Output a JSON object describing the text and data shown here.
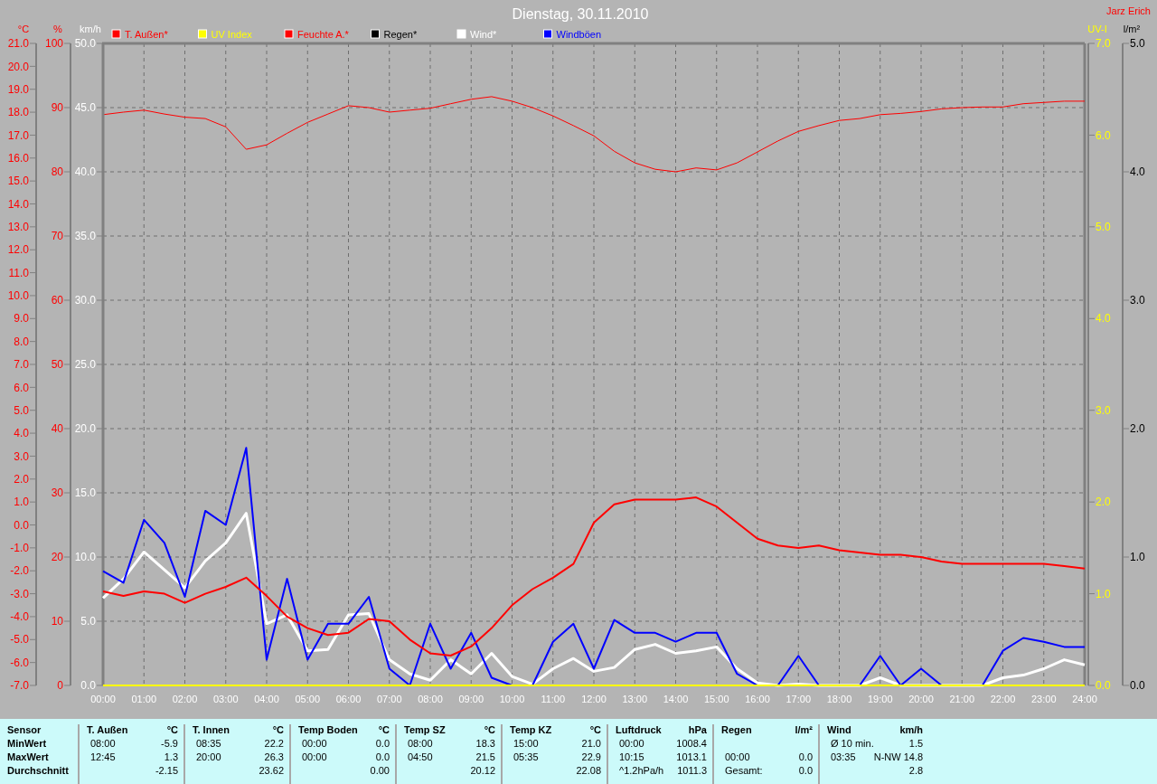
{
  "chart": {
    "title": "Dienstag, 30.11.2010",
    "author": "Jarz Erich",
    "panels": [
      {
        "chart_data": {
          "type": "line",
          "ylabel": "°C",
          "ylim": [
            -7,
            21
          ],
          "xlim": [
            0,
            24
          ],
          "grid": true,
          "x": [
            0,
            0.5,
            1,
            1.5,
            2,
            2.5,
            3,
            3.5,
            4,
            4.5,
            5,
            5.5,
            6,
            6.5,
            7,
            7.5,
            8,
            8.5,
            9,
            9.5,
            10,
            10.5,
            11,
            11.5,
            12,
            12.5,
            13,
            13.5,
            14,
            14.5,
            15,
            15.5,
            16,
            16.5,
            17,
            17.5,
            18,
            18.5,
            19,
            19.5,
            20,
            20.5,
            21,
            21.5,
            22,
            22.5,
            23,
            23.5,
            24
          ],
          "xticks": [
            {
              "value": 0,
              "label": "00:00"
            },
            {
              "value": 1,
              "label": "01:00"
            },
            {
              "value": 2,
              "label": "02:00"
            },
            {
              "value": 3,
              "label": "03:00"
            },
            {
              "value": 4,
              "label": "04:00"
            },
            {
              "value": 5,
              "label": "05:00"
            },
            {
              "value": 6,
              "label": "06:00"
            },
            {
              "value": 7,
              "label": "07:00"
            },
            {
              "value": 8,
              "label": "08:00"
            },
            {
              "value": 9,
              "label": "09:00"
            },
            {
              "value": 10,
              "label": "10:00"
            },
            {
              "value": 11,
              "label": "11:00"
            },
            {
              "value": 12,
              "label": "12:00"
            },
            {
              "value": 13,
              "label": "13:00"
            },
            {
              "value": 14,
              "label": "14:00"
            },
            {
              "value": 15,
              "label": "15:00"
            },
            {
              "value": 16,
              "label": "16:00"
            },
            {
              "value": 17,
              "label": "17:00"
            },
            {
              "value": 18,
              "label": "18:00"
            },
            {
              "value": 19,
              "label": "19:00"
            },
            {
              "value": 20,
              "label": "20:00"
            },
            {
              "value": 21,
              "label": "21:00"
            },
            {
              "value": 22,
              "label": "22:00"
            },
            {
              "value": 23,
              "label": "23:00"
            },
            {
              "value": 24,
              "label": "24:00"
            }
          ],
          "yticks": [
            {
              "value": -7,
              "label": "-7.0"
            },
            {
              "value": -6,
              "label": "-6.0"
            },
            {
              "value": -5,
              "label": "-5.0"
            },
            {
              "value": -4,
              "label": "-4.0"
            },
            {
              "value": -3,
              "label": "-3.0"
            },
            {
              "value": -2,
              "label": "-2.0"
            },
            {
              "value": -1,
              "label": "-1.0"
            },
            {
              "value": 0,
              "label": "0.0"
            },
            {
              "value": 1,
              "label": "1.0"
            },
            {
              "value": 2,
              "label": "2.0"
            },
            {
              "value": 3,
              "label": "3.0"
            },
            {
              "value": 4,
              "label": "4.0"
            },
            {
              "value": 5,
              "label": "5.0"
            },
            {
              "value": 6,
              "label": "6.0"
            },
            {
              "value": 7,
              "label": "7.0"
            },
            {
              "value": 8,
              "label": "8.0"
            },
            {
              "value": 9,
              "label": "9.0"
            },
            {
              "value": 10,
              "label": "10.0"
            },
            {
              "value": 11,
              "label": "11.0"
            },
            {
              "value": 12,
              "label": "12.0"
            },
            {
              "value": 13,
              "label": "13.0"
            },
            {
              "value": 14,
              "label": "14.0"
            },
            {
              "value": 15,
              "label": "15.0"
            },
            {
              "value": 16,
              "label": "16.0"
            },
            {
              "value": 17,
              "label": "17.0"
            },
            {
              "value": 18,
              "label": "18.0"
            },
            {
              "value": 19,
              "label": "19.0"
            },
            {
              "value": 20,
              "label": "20.0"
            },
            {
              "value": 21,
              "label": "21.0"
            }
          ],
          "series": [
            {
              "name": "T. Außen*",
              "color": "#ff0000",
              "values": [
                -2.9,
                -3.1,
                -2.9,
                -3.0,
                -3.4,
                -3.0,
                -2.7,
                -2.3,
                -3.1,
                -4.0,
                -4.5,
                -4.8,
                -4.7,
                -4.1,
                -4.2,
                -5.0,
                -5.6,
                -5.7,
                -5.3,
                -4.5,
                -3.5,
                -2.8,
                -2.3,
                -1.7,
                0.1,
                0.9,
                1.1,
                1.1,
                1.1,
                1.2,
                0.8,
                0.1,
                -0.6,
                -0.9,
                -1.0,
                -0.9,
                -1.1,
                -1.2,
                -1.3,
                -1.3,
                -1.4,
                -1.6,
                -1.7,
                -1.7,
                -1.7,
                -1.7,
                -1.7,
                -1.8,
                -1.9
              ]
            }
          ]
        }
      },
      {
        "chart_data": {
          "type": "line",
          "ylabel": "UV-I",
          "ylim": [
            0,
            7
          ],
          "categories": [
            null,
            null,
            null,
            null,
            null,
            null,
            null,
            null,
            null,
            null,
            null,
            null,
            null,
            null,
            null,
            null,
            null,
            null,
            null,
            null,
            null,
            null,
            null,
            null,
            null,
            null,
            null,
            null,
            null,
            null,
            null,
            null,
            null,
            null,
            null,
            null,
            null,
            null,
            null,
            null,
            null,
            null,
            null,
            null,
            null,
            null,
            null,
            null,
            null
          ],
          "yticks": [
            {
              "value": 0,
              "label": "0.0"
            },
            {
              "value": 1,
              "label": "1.0"
            },
            {
              "value": 2,
              "label": "2.0"
            },
            {
              "value": 3,
              "label": "3.0"
            },
            {
              "value": 4,
              "label": "4.0"
            },
            {
              "value": 5,
              "label": "5.0"
            },
            {
              "value": 6,
              "label": "6.0"
            },
            {
              "value": 7,
              "label": "7.0"
            }
          ],
          "series": [
            {
              "name": "UV Index",
              "color": "#ffff00",
              "values": [
                0,
                0,
                0,
                0,
                0,
                0,
                0,
                0,
                0,
                0,
                0,
                0,
                0,
                0,
                0,
                0,
                0,
                0,
                0,
                0,
                0,
                0,
                0,
                0,
                0,
                0,
                0,
                0,
                0,
                0,
                0,
                0,
                0,
                0,
                0,
                0,
                0,
                0,
                0,
                0,
                0,
                0,
                0,
                0,
                0,
                0,
                0,
                0,
                0
              ]
            }
          ]
        }
      },
      {
        "chart_data": {
          "type": "line",
          "ylabel": "%",
          "ylim": [
            0,
            100
          ],
          "categories": [
            null,
            null,
            null,
            null,
            null,
            null,
            null,
            null,
            null,
            null,
            null,
            null,
            null,
            null,
            null,
            null,
            null,
            null,
            null,
            null,
            null,
            null,
            null,
            null,
            null,
            null,
            null,
            null,
            null,
            null,
            null,
            null,
            null,
            null,
            null,
            null,
            null,
            null,
            null,
            null,
            null,
            null,
            null,
            null,
            null,
            null,
            null,
            null,
            null
          ],
          "yticks": [
            0,
            10,
            20,
            30,
            40,
            50,
            60,
            70,
            80,
            90,
            100
          ],
          "series": [
            {
              "name": "Feuchte A.*",
              "color": "#ff0000",
              "values": [
                88.9,
                89.3,
                89.6,
                89.0,
                88.5,
                88.3,
                87.0,
                83.5,
                84.2,
                86.0,
                87.7,
                89.0,
                90.3,
                90.0,
                89.3,
                89.6,
                89.9,
                90.6,
                91.3,
                91.7,
                91.0,
                90.0,
                88.7,
                87.2,
                85.6,
                83.2,
                81.4,
                80.4,
                80.0,
                80.6,
                80.3,
                81.4,
                83.1,
                84.8,
                86.3,
                87.2,
                88.0,
                88.3,
                88.9,
                89.1,
                89.4,
                89.8,
                90.0,
                90.1,
                90.1,
                90.6,
                90.8,
                91.0,
                91.0
              ]
            }
          ]
        }
      },
      {
        "chart_data": {
          "type": "line",
          "ylabel": "km/h",
          "ylim": [
            0,
            50
          ],
          "grid": true,
          "categories": [
            null,
            null,
            null,
            null,
            null,
            null,
            null,
            null,
            null,
            null,
            null,
            null,
            null,
            null,
            null,
            null,
            null,
            null,
            null,
            null,
            null,
            null,
            null,
            null,
            null,
            null,
            null,
            null,
            null,
            null,
            null,
            null,
            null,
            null,
            null,
            null,
            null,
            null,
            null,
            null,
            null,
            null,
            null,
            null,
            null,
            null,
            null,
            null,
            null
          ],
          "yticks": [
            {
              "value": 0,
              "label": "0.0"
            },
            {
              "value": 5,
              "label": "5.0"
            },
            {
              "value": 10,
              "label": "10.0"
            },
            {
              "value": 15,
              "label": "15.0"
            },
            {
              "value": 20,
              "label": "20.0"
            },
            {
              "value": 25,
              "label": "25.0"
            },
            {
              "value": 30,
              "label": "30.0"
            },
            {
              "value": 35,
              "label": "35.0"
            },
            {
              "value": 40,
              "label": "40.0"
            },
            {
              "value": 45,
              "label": "45.0"
            },
            {
              "value": 50,
              "label": "50.0"
            }
          ],
          "series": [
            {
              "name": "Wind*",
              "color": "#ffffff",
              "values": [
                6.8,
                8.3,
                10.4,
                9.0,
                7.6,
                9.7,
                11.1,
                13.4,
                4.8,
                5.5,
                2.7,
                2.8,
                5.5,
                5.6,
                2.0,
                0.9,
                0.4,
                2.0,
                0.9,
                2.5,
                0.7,
                0.1,
                1.3,
                2.1,
                1.1,
                1.4,
                2.8,
                3.2,
                2.5,
                2.7,
                3.0,
                1.3,
                0.2,
                0.0,
                0.1,
                0.0,
                0.0,
                0.0,
                0.6,
                0.0,
                0.0,
                0.0,
                0.0,
                0.0,
                0.6,
                0.8,
                1.3,
                2.0,
                1.6
              ]
            },
            {
              "name": "Windböen",
              "color": "#0000ff",
              "values": [
                8.9,
                8.0,
                12.9,
                11.1,
                6.9,
                13.6,
                12.5,
                18.5,
                2.0,
                8.3,
                2.0,
                4.8,
                4.8,
                6.9,
                1.3,
                0.0,
                4.8,
                1.3,
                4.1,
                0.6,
                0.0,
                0.0,
                3.4,
                4.8,
                1.3,
                5.1,
                4.1,
                4.1,
                3.4,
                4.1,
                4.1,
                0.9,
                0.0,
                0.0,
                2.3,
                0.0,
                0.0,
                0.0,
                2.3,
                0.0,
                1.3,
                0.0,
                0.0,
                0.0,
                2.7,
                3.7,
                3.4,
                3.0,
                3.0
              ]
            }
          ]
        }
      }
    ],
    "rain_axis": {
      "unit": "l/m²",
      "ticks": [
        "5.0",
        "4.0",
        "3.0",
        "2.0",
        "1.0",
        "0.0"
      ],
      "legend": {
        "name": "Regen*",
        "color": "#000000"
      }
    }
  },
  "stats": {
    "corner": "Sensor",
    "row_labels": [
      "MinWert",
      "MaxWert",
      "Durchschnitt"
    ],
    "groups": [
      {
        "name": "T. Außen",
        "unit": "°C",
        "rows": [
          {
            "time": "08:00",
            "value": "-5.9"
          },
          {
            "time": "12:45",
            "value": "1.3"
          },
          {
            "value": "-2.15"
          }
        ]
      },
      {
        "name": "T. Innen",
        "unit": "°C",
        "rows": [
          {
            "time": "08:35",
            "value": "22.2"
          },
          {
            "time": "20:00",
            "value": "26.3"
          },
          {
            "value": "23.62"
          }
        ]
      },
      {
        "name": "Temp Boden",
        "unit": "°C",
        "rows": [
          {
            "time": "00:00",
            "value": "0.0"
          },
          {
            "time": "00:00",
            "value": "0.0"
          },
          {
            "value": "0.00"
          }
        ]
      },
      {
        "name": "Temp SZ",
        "unit": "°C",
        "rows": [
          {
            "time": "08:00",
            "value": "18.3"
          },
          {
            "time": "04:50",
            "value": "21.5"
          },
          {
            "value": "20.12"
          }
        ]
      },
      {
        "name": "Temp KZ",
        "unit": "°C",
        "rows": [
          {
            "time": "15:00",
            "value": "21.0"
          },
          {
            "time": "05:35",
            "value": "22.9"
          },
          {
            "value": "22.08"
          }
        ]
      },
      {
        "name": "Luftdruck",
        "unit": "hPa",
        "rows": [
          {
            "time": "00:00",
            "value": "1008.4"
          },
          {
            "time": "10:15",
            "value": "1013.1"
          },
          {
            "time": "^1.2hPa/h",
            "value": "1011.3"
          }
        ]
      },
      {
        "name": "Regen",
        "unit": "l/m²",
        "rows": [
          {},
          {
            "time": "00:00",
            "value": "0.0"
          },
          {
            "time": "Gesamt:",
            "value": "0.0"
          }
        ]
      },
      {
        "name": "Wind",
        "unit": "km/h",
        "rows": [
          {
            "time": "Ø 10 min.",
            "value": "1.5"
          },
          {
            "time": "03:35",
            "value": "N-NW 14.8"
          },
          {
            "value": "2.8"
          }
        ]
      }
    ]
  }
}
